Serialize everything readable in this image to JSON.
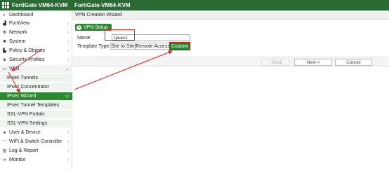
{
  "topbar": {
    "brand": "FortiGate VM64-KVM",
    "hostname": "FortiGate-VM64-KVM"
  },
  "sidebar": {
    "items": [
      {
        "label": "Dashboard",
        "icon": "dashboard-icon",
        "glyph": "◐"
      },
      {
        "label": "FortiView",
        "icon": "chart-icon",
        "glyph": "▟"
      },
      {
        "label": "Network",
        "icon": "network-icon",
        "glyph": "✥"
      },
      {
        "label": "System",
        "icon": "gear-icon",
        "glyph": "✹"
      },
      {
        "label": "Policy & Objects",
        "icon": "policy-icon",
        "glyph": "▙"
      },
      {
        "label": "Security Profiles",
        "icon": "lock-icon",
        "glyph": "◈"
      },
      {
        "label": "VPN",
        "icon": "monitor-icon",
        "glyph": "▭"
      },
      {
        "label": "IPsec Tunnels"
      },
      {
        "label": "IPsec Concentrator"
      },
      {
        "label": "IPsec Wizard"
      },
      {
        "label": "IPsec Tunnel Templates"
      },
      {
        "label": "SSL-VPN Portals"
      },
      {
        "label": "SSL-VPN Settings"
      },
      {
        "label": "User & Device",
        "icon": "user-icon",
        "glyph": "●"
      },
      {
        "label": "WiFi & Switch Controller",
        "icon": "wifi-icon",
        "glyph": "◠"
      },
      {
        "label": "Log & Report",
        "icon": "report-icon",
        "glyph": "▥"
      },
      {
        "label": "Monitor",
        "icon": "monitor-pie-icon",
        "glyph": "◕"
      }
    ]
  },
  "main": {
    "header": "VPN Creation Wizard",
    "step": {
      "number": "1",
      "label": "VPN Setup"
    },
    "name_label": "Name",
    "name_value": "ipsec1",
    "template_label": "Template Type",
    "template_options": [
      "Site to Site",
      "Remote Access",
      "Custom"
    ],
    "template_selected": "Custom",
    "buttons": {
      "back": "< Back",
      "next": "Next >",
      "cancel": "Cancel"
    }
  },
  "colors": {
    "brand_green": "#2c6a35",
    "active_green": "#2b8a2f",
    "annotation_red": "#e02020"
  }
}
